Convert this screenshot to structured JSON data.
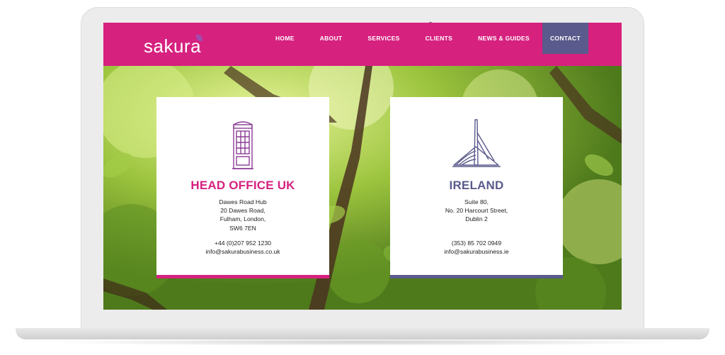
{
  "brand": {
    "logo_text": "sakura",
    "primary_color": "#d6217f",
    "secondary_color": "#5a5a8c"
  },
  "nav": {
    "items": [
      {
        "label": "HOME"
      },
      {
        "label": "ABOUT"
      },
      {
        "label": "SERVICES"
      },
      {
        "label": "CLIENTS"
      },
      {
        "label": "NEWS & GUIDES"
      },
      {
        "label": "CONTACT",
        "active": true
      }
    ]
  },
  "offices": {
    "uk": {
      "icon": "phone-box-icon",
      "title": "HEAD OFFICE UK",
      "address": [
        "Dawes Road Hub",
        "20 Dawes Road,",
        "Fulham, London,",
        "SW6 7EN"
      ],
      "phone": "+44 (0)207 952 1230",
      "email": "info@sakurabusiness.co.uk"
    },
    "ireland": {
      "icon": "bridge-icon",
      "title": "IRELAND",
      "address": [
        "Suite 80,",
        "No. 20 Harcourt Street,",
        "Dublin 2"
      ],
      "phone": "(353) 85 702 0949",
      "email": "info@sakurabusiness.ie"
    }
  }
}
